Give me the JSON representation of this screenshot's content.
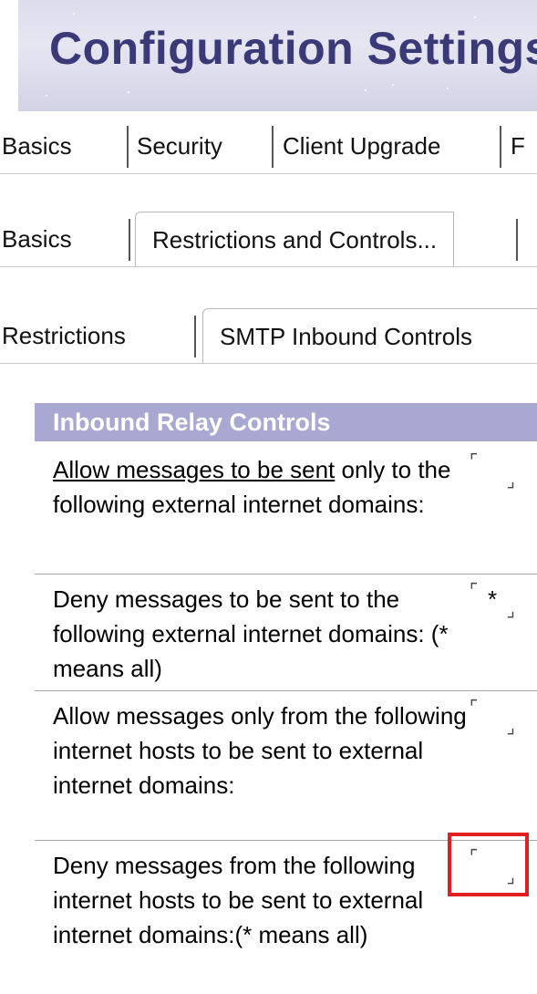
{
  "window": {
    "title": "Configuration Settings"
  },
  "tabs_level1": [
    {
      "label": "Basics",
      "active": false
    },
    {
      "label": "Security",
      "active": false
    },
    {
      "label": "Client Upgrade",
      "active": false
    },
    {
      "label": "F",
      "active": false
    }
  ],
  "tabs_level2": [
    {
      "label": "Basics",
      "active": false
    },
    {
      "label": "Restrictions and Controls...",
      "active": true
    }
  ],
  "tabs_level3": [
    {
      "label": "Restrictions",
      "active": false
    },
    {
      "label": "SMTP Inbound Controls",
      "active": true
    }
  ],
  "section": {
    "title": "Inbound Relay Controls",
    "rows": [
      {
        "label_link": "Allow messages to be sent",
        "label_rest": " only to the following external internet domains:",
        "value": ""
      },
      {
        "label": "Deny messages to be sent to the following external internet domains: (* means all)",
        "value": "*"
      },
      {
        "label": "Allow messages only from the following internet hosts to be sent to external internet domains:",
        "value": ""
      },
      {
        "label": "Deny messages from the following internet hosts to be sent to external internet domains:(* means all)",
        "value": ""
      }
    ]
  },
  "icons": {
    "field_open": "⌜",
    "field_close": "⌟"
  },
  "colors": {
    "banner_title": "#3a3a78",
    "section_header_bg": "#a8a8d2",
    "highlight_box": "#e02020"
  }
}
